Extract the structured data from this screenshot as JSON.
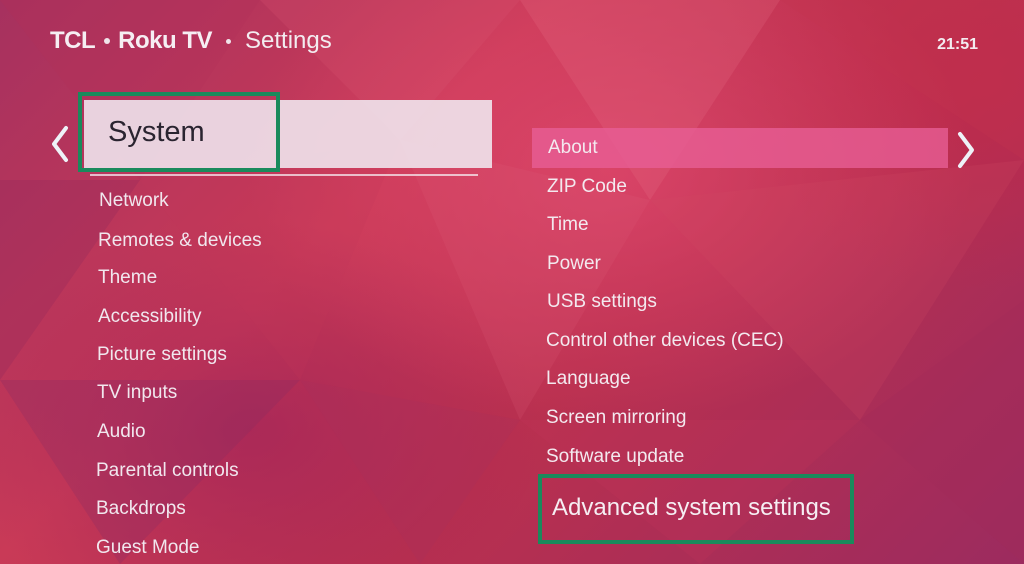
{
  "header": {
    "brand_tcl": "TCL",
    "brand_roku": "Roku TV",
    "title": "Settings",
    "clock": "21:51"
  },
  "category": {
    "selected_label": "System"
  },
  "left_menu": {
    "items": [
      "Network",
      "Remotes & devices",
      "Theme",
      "Accessibility",
      "Picture settings",
      "TV inputs",
      "Audio",
      "Parental controls",
      "Backdrops",
      "Guest Mode"
    ]
  },
  "right_menu": {
    "selected_index": 0,
    "items": [
      "About",
      "ZIP Code",
      "Time",
      "Power",
      "USB settings",
      "Control other devices (CEC)",
      "Language",
      "Screen mirroring",
      "Software update"
    ],
    "highlighted_item": "Advanced system settings"
  },
  "icons": {
    "left": "chevron-left-icon",
    "right": "chevron-right-icon"
  },
  "colors": {
    "highlight_border": "#1a8a5c",
    "selected_row": "#e85f96",
    "background": "#c93a57"
  }
}
